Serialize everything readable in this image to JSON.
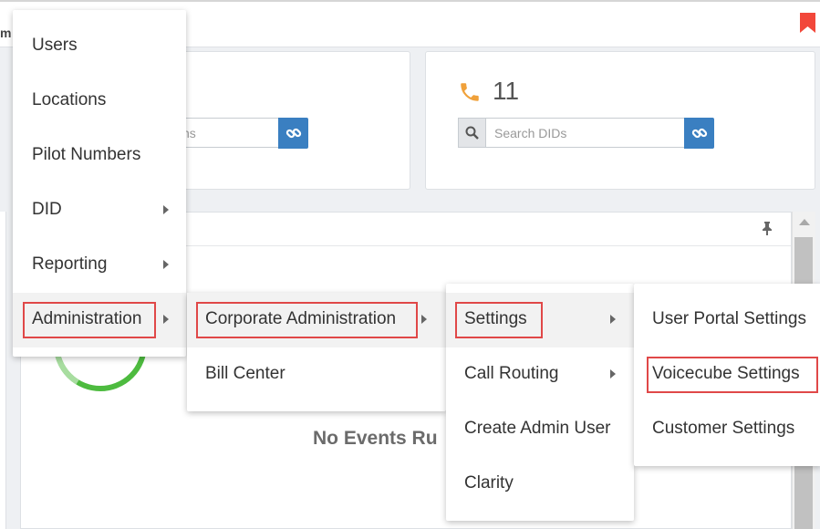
{
  "topbar": {
    "fragment": "m"
  },
  "did": {
    "count": "11",
    "search_placeholder": "Search DIDs"
  },
  "locations": {
    "placeholder_fragment": "ns"
  },
  "events": {
    "no_events": "No Events Ru"
  },
  "colors": {
    "accent": "#3a7fc1",
    "highlight": "#e04848",
    "phone": "#f0a13a",
    "donut": "#4dbb3f",
    "bookmark": "#f2473a"
  },
  "menu": {
    "main": [
      {
        "label": "Users"
      },
      {
        "label": "Locations"
      },
      {
        "label": "Pilot Numbers"
      },
      {
        "label": "DID"
      },
      {
        "label": "Reporting"
      },
      {
        "label": "Administration"
      }
    ],
    "administration": [
      {
        "label": "Corporate Administration"
      },
      {
        "label": "Bill Center"
      }
    ],
    "corporate": [
      {
        "label": "Settings"
      },
      {
        "label": "Call Routing"
      },
      {
        "label": "Create Admin User"
      },
      {
        "label": "Clarity"
      }
    ],
    "settings": [
      {
        "label": "User Portal Settings"
      },
      {
        "label": "Voicecube Settings"
      },
      {
        "label": "Customer Settings"
      }
    ]
  }
}
